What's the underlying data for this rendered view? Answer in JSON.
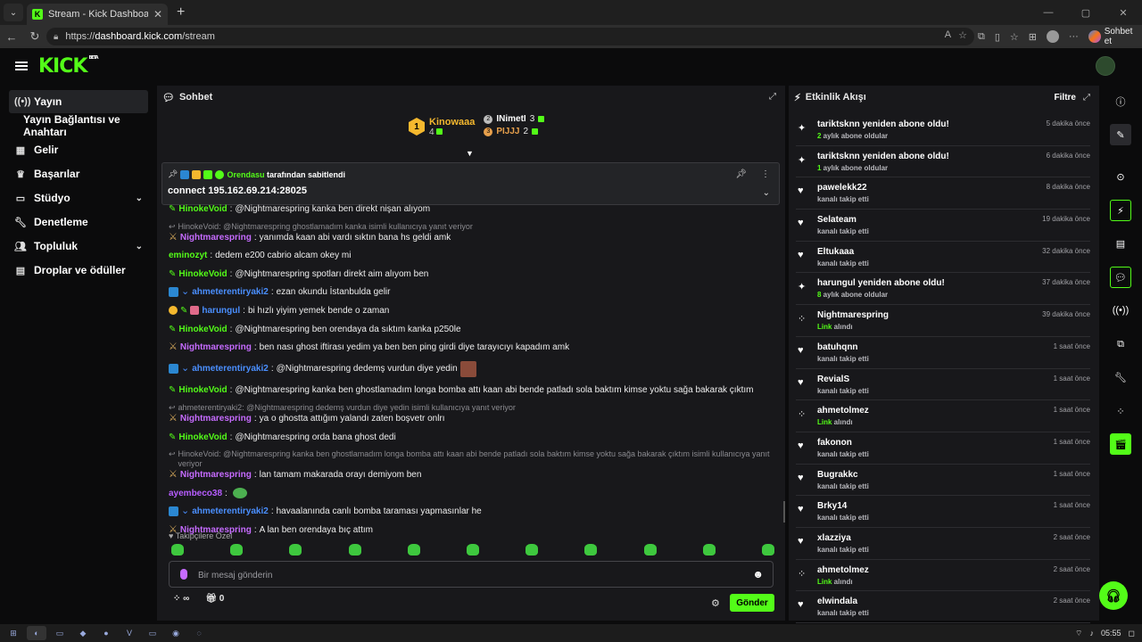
{
  "browser": {
    "tab_title": "Stream - Kick Dashboard",
    "url_prefix": "https://",
    "url_host": "dashboard.kick.com",
    "url_path": "/stream",
    "copilot_label": "Sohbet et"
  },
  "header": {
    "logo": "KICK",
    "beta": "BETA"
  },
  "sidebar": {
    "items": [
      {
        "label": "Yayın",
        "icon": "broadcast-icon"
      },
      {
        "label": "Yayın Bağlantısı ve Anahtarı",
        "icon": ""
      },
      {
        "label": "Gelir",
        "icon": "revenue-icon"
      },
      {
        "label": "Başarılar",
        "icon": "trophy-icon"
      },
      {
        "label": "Stüdyo",
        "icon": "studio-icon"
      },
      {
        "label": "Denetleme",
        "icon": "wrench-icon"
      },
      {
        "label": "Topluluk",
        "icon": "community-icon"
      },
      {
        "label": "Droplar ve ödüller",
        "icon": "drops-icon"
      }
    ]
  },
  "chat": {
    "title": "Sohbet",
    "top_gifters": {
      "first": {
        "rank": "1",
        "name": "Kinowaaa",
        "count": "4"
      },
      "second": {
        "name": "INimetI",
        "count": "3"
      },
      "third": {
        "name": "PIJJJ",
        "count": "2"
      }
    },
    "pinned": {
      "by_user": "Orendasu",
      "by_text": "tarafından sabitlendi",
      "message": "connect 195.162.69.214:28025"
    },
    "messages": [
      {
        "type": "msg",
        "badge": "pen",
        "user": "HinokeVoid",
        "color": "g",
        "text": "@Nightmarespring kanka ben direkt nişan alıyom"
      },
      {
        "type": "reply",
        "text": "HinokeVoid: @Nightmarespring ghostlamadım kanka isimli kullanıcıya yanıt veriyor"
      },
      {
        "type": "msg",
        "badge": "sword",
        "user": "Nightmarespring",
        "color": "p",
        "text": "yanımda kaan abi vardı sıktın bana hs geldi amk"
      },
      {
        "type": "msg",
        "badge": "",
        "user": "eminozyt",
        "color": "g",
        "text": "dedem e200 cabrio alcam okey mi"
      },
      {
        "type": "msg",
        "badge": "pen",
        "user": "HinokeVoid",
        "color": "g",
        "text": "@Nightmarespring spotları direkt aim alıyom ben"
      },
      {
        "type": "msg",
        "badge": "blue",
        "user": "ahmeterentiryaki2",
        "color": "b",
        "text": "ezan okundu İstanbulda gelir"
      },
      {
        "type": "msg",
        "badge": "multi",
        "user": "harungul",
        "color": "b",
        "text": "bi hızlı yiyim yemek bende o zaman"
      },
      {
        "type": "msg",
        "badge": "pen",
        "user": "HinokeVoid",
        "color": "g",
        "text": "@Nightmarespring ben orendaya da sıktım kanka p250le"
      },
      {
        "type": "msg",
        "badge": "sword",
        "user": "Nightmarespring",
        "color": "p",
        "text": "ben nası ghost iftirası yedim ya ben ben ping girdi diye tarayıcıyı kapadım amk"
      },
      {
        "type": "msg",
        "badge": "blue",
        "user": "ahmeterentiryaki2",
        "color": "b",
        "text": "@Nightmarespring dedemş vurdun diye yedin"
      },
      {
        "type": "msg",
        "badge": "pen",
        "user": "HinokeVoid",
        "color": "g",
        "text": "@Nightmarespring kanka ben ghostlamadım longa bomba attı kaan abi bende patladı sola baktım kimse yoktu sağa bakarak çıktım"
      },
      {
        "type": "reply",
        "text": "ahmeterentiryaki2: @Nightmarespring dedemş vurdun diye yedin isimli kullanıcıya yanıt veriyor"
      },
      {
        "type": "msg",
        "badge": "sword",
        "user": "Nightmarespring",
        "color": "p",
        "text": "ya o ghostta attığım yalandı zaten boşvetr onlrı"
      },
      {
        "type": "msg",
        "badge": "pen",
        "user": "HinokeVoid",
        "color": "g",
        "text": "@Nightmarespring orda bana ghost dedi"
      },
      {
        "type": "reply",
        "text": "HinokeVoid: @Nightmarespring kanka ben ghostlamadım longa bomba attı kaan abi bende patladı sola baktım kimse yoktu sağa bakarak çıktım isimli kullanıcıya yanıt veriyor"
      },
      {
        "type": "msg",
        "badge": "sword",
        "user": "Nightmarespring",
        "color": "p",
        "text": "lan tamam makarada orayı demiyom ben"
      },
      {
        "type": "msg",
        "badge": "",
        "user": "ayembeco38",
        "color": "pu",
        "text": ""
      },
      {
        "type": "msg",
        "badge": "blue",
        "user": "ahmeterentiryaki2",
        "color": "b",
        "text": "havaalanında canlı bomba taraması yapmasınlar he"
      },
      {
        "type": "msg",
        "badge": "sword",
        "user": "Nightmarespring",
        "color": "p",
        "text": "A lan ben orendaya bıç attım"
      }
    ],
    "followers_only": "Takipçilere Özel",
    "input_placeholder": "Bir mesaj gönderin",
    "kicks_count": "∞",
    "gift_count": "0",
    "send_label": "Gönder"
  },
  "activity": {
    "title": "Etkinlik Akışı",
    "filter_label": "Filtre",
    "events": [
      {
        "icon": "sparkle-icon",
        "name": "tariktsknn yeniden abone oldu!",
        "hl": "2",
        "detail": " aylık abone oldular",
        "time": "5 dakika önce"
      },
      {
        "icon": "sparkle-icon",
        "name": "tariktsknn yeniden abone oldu!",
        "hl": "1",
        "detail": " aylık abone oldular",
        "time": "6 dakika önce"
      },
      {
        "icon": "heart-icon",
        "name": "pawelekk22",
        "hl": "",
        "detail": "kanalı takip etti",
        "time": "8 dakika önce"
      },
      {
        "icon": "heart-icon",
        "name": "Selateam",
        "hl": "",
        "detail": "kanalı takip etti",
        "time": "19 dakika önce"
      },
      {
        "icon": "heart-icon",
        "name": "Eltukaaa",
        "hl": "",
        "detail": "kanalı takip etti",
        "time": "32 dakika önce"
      },
      {
        "icon": "sparkle-icon",
        "name": "harungul yeniden abone oldu!",
        "hl": "8",
        "detail": " aylık abone oldular",
        "time": "37 dakika önce"
      },
      {
        "icon": "dots-icon",
        "name": "Nightmarespring",
        "hl": "Link",
        "detail": " alındı",
        "time": "39 dakika önce"
      },
      {
        "icon": "heart-icon",
        "name": "batuhqnn",
        "hl": "",
        "detail": "kanalı takip etti",
        "time": "1 saat önce"
      },
      {
        "icon": "heart-icon",
        "name": "RevialS",
        "hl": "",
        "detail": "kanalı takip etti",
        "time": "1 saat önce"
      },
      {
        "icon": "dots-icon",
        "name": "ahmetolmez",
        "hl": "Link",
        "detail": " alındı",
        "time": "1 saat önce"
      },
      {
        "icon": "heart-icon",
        "name": "fakonon",
        "hl": "",
        "detail": "kanalı takip etti",
        "time": "1 saat önce"
      },
      {
        "icon": "heart-icon",
        "name": "Bugrakkc",
        "hl": "",
        "detail": "kanalı takip etti",
        "time": "1 saat önce"
      },
      {
        "icon": "heart-icon",
        "name": "Brky14",
        "hl": "",
        "detail": "kanalı takip etti",
        "time": "1 saat önce"
      },
      {
        "icon": "heart-icon",
        "name": "xlazziya",
        "hl": "",
        "detail": "kanalı takip etti",
        "time": "2 saat önce"
      },
      {
        "icon": "dots-icon",
        "name": "ahmetolmez",
        "hl": "Link",
        "detail": " alındı",
        "time": "2 saat önce"
      },
      {
        "icon": "heart-icon",
        "name": "elwindala",
        "hl": "",
        "detail": "kanalı takip etti",
        "time": "2 saat önce"
      }
    ]
  },
  "taskbar": {
    "clock": "05:55"
  },
  "colors": {
    "accent": "#53fc18",
    "panel": "#18181b",
    "page": "#0b0b0c"
  }
}
